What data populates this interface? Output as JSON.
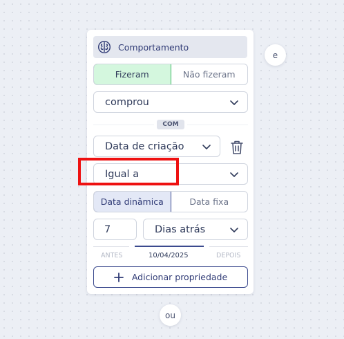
{
  "header": {
    "icon": "brain-icon",
    "title": "Comportamento"
  },
  "behavior_toggle": {
    "options": [
      "Fizeram",
      "Não fizeram"
    ],
    "selected": "Fizeram",
    "selected_color": "#d4f7de"
  },
  "event_select": {
    "value": "comprou"
  },
  "connector_badge": "COM",
  "property_select": {
    "value": "Data de criação"
  },
  "operator_select": {
    "value": "Igual a"
  },
  "date_mode_toggle": {
    "options": [
      "Data dinâmica",
      "Data fixa"
    ],
    "selected": "Data dinâmica"
  },
  "offset_input": {
    "value": "7"
  },
  "unit_select": {
    "value": "Dias atrás"
  },
  "timeline": {
    "before_label": "ANTES",
    "date_label": "10/04/2025",
    "after_label": "DEPOIS"
  },
  "add_property_button": {
    "label": "Adicionar propriedade"
  },
  "and_button": {
    "label": "e"
  },
  "or_button": {
    "label": "ou"
  },
  "colors": {
    "accent": "#3b4a8e",
    "highlight": "#ee1111",
    "success_border": "#3fb865"
  }
}
